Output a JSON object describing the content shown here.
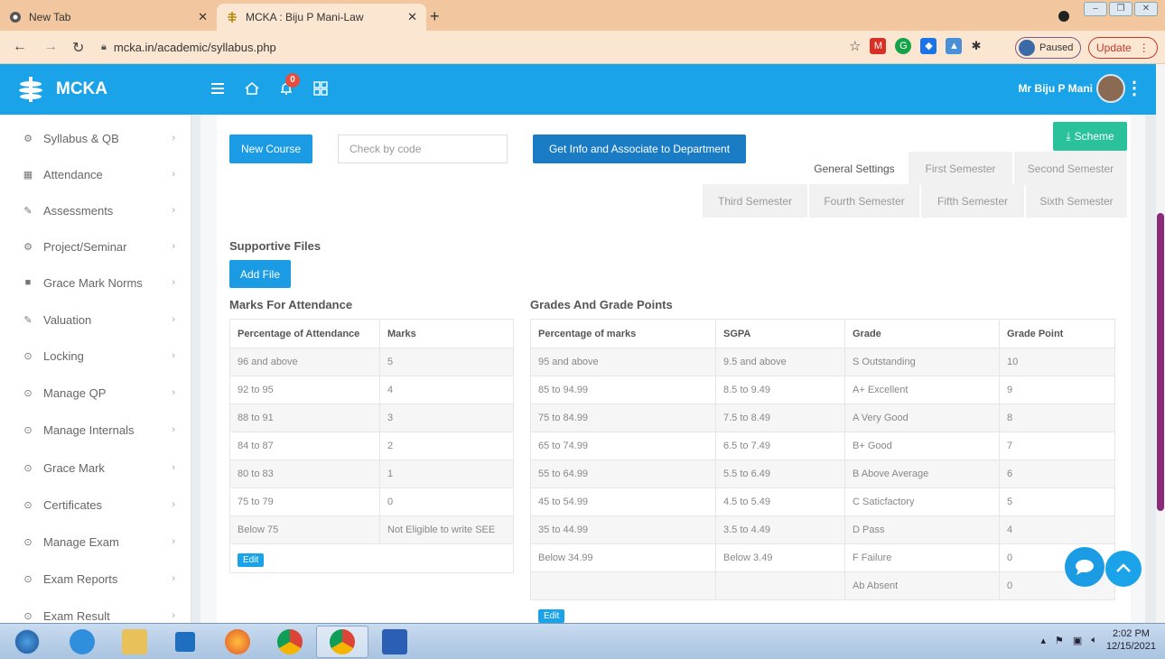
{
  "browser": {
    "tabs": [
      {
        "title": "New Tab",
        "icon": "chrome-icon"
      },
      {
        "title": "MCKA : Biju P Mani-Law",
        "icon": "mcka-favicon"
      }
    ],
    "url": "mcka.in/academic/syllabus.php",
    "profile_status": "Paused",
    "update_label": "Update"
  },
  "app": {
    "brand": "MCKA",
    "notification_count": "0",
    "user_name": "Mr Biju P Mani",
    "accent": "#1aa3e8"
  },
  "sidebar": {
    "items": [
      {
        "label": "Syllabus & QB",
        "icon": "cogs-icon"
      },
      {
        "label": "Attendance",
        "icon": "calendar-icon"
      },
      {
        "label": "Assessments",
        "icon": "pencil-icon"
      },
      {
        "label": "Project/Seminar",
        "icon": "cogs-icon"
      },
      {
        "label": "Grace Mark Norms",
        "icon": "book-icon"
      },
      {
        "label": "Valuation",
        "icon": "pencil-icon"
      },
      {
        "label": "Locking",
        "icon": "circle-arrow-icon"
      },
      {
        "label": "Manage QP",
        "icon": "circle-arrow-icon"
      },
      {
        "label": "Manage Internals",
        "icon": "circle-arrow-icon"
      },
      {
        "label": "Grace Mark",
        "icon": "circle-arrow-icon"
      },
      {
        "label": "Certificates",
        "icon": "circle-arrow-icon"
      },
      {
        "label": "Manage Exam",
        "icon": "circle-arrow-icon"
      },
      {
        "label": "Exam Reports",
        "icon": "circle-arrow-icon"
      },
      {
        "label": "Exam Result",
        "icon": "circle-arrow-icon"
      }
    ]
  },
  "main": {
    "new_course_label": "New Course",
    "check_code_placeholder": "Check by code",
    "get_info_label": "Get Info and Associate to Department",
    "scheme_label": "Scheme",
    "tabs_row1": [
      "General Settings",
      "First Semester",
      "Second Semester"
    ],
    "tabs_row2": [
      "Third Semester",
      "Fourth Semester",
      "Fifth Semester",
      "Sixth Semester"
    ],
    "supportive_files_title": "Supportive Files",
    "add_file_label": "Add File",
    "attendance_title": "Marks For Attendance",
    "attendance_headers": [
      "Percentage of Attendance",
      "Marks"
    ],
    "attendance_rows": [
      [
        "96 and above",
        "5"
      ],
      [
        "92 to 95",
        "4"
      ],
      [
        "88 to 91",
        "3"
      ],
      [
        "84 to 87",
        "2"
      ],
      [
        "80 to 83",
        "1"
      ],
      [
        "75 to 79",
        "0"
      ],
      [
        "Below 75",
        "Not Eligible to write SEE"
      ]
    ],
    "grades_title": "Grades And Grade Points",
    "grades_headers": [
      "Percentage of marks",
      "SGPA",
      "Grade",
      "Grade Point"
    ],
    "grades_rows": [
      [
        "95 and above",
        "9.5 and above",
        "S Outstanding",
        "10"
      ],
      [
        "85 to 94.99",
        "8.5 to 9.49",
        "A+ Excellent",
        "9"
      ],
      [
        "75 to 84.99",
        "7.5 to 8.49",
        "A Very Good",
        "8"
      ],
      [
        "65 to 74.99",
        "6.5 to 7.49",
        "B+ Good",
        "7"
      ],
      [
        "55 to 64.99",
        "5.5 to 6.49",
        "B Above Average",
        "6"
      ],
      [
        "45 to 54.99",
        "4.5 to 5.49",
        "C Saticfactory",
        "5"
      ],
      [
        "35 to 44.99",
        "3.5 to 4.49",
        "D Pass",
        "4"
      ],
      [
        "Below 34.99",
        "Below 3.49",
        "F Failure",
        "0"
      ],
      [
        "",
        "",
        "Ab Absent",
        "0"
      ]
    ],
    "edit_label": "Edit"
  },
  "taskbar": {
    "time": "2:02 PM",
    "date": "12/15/2021"
  }
}
